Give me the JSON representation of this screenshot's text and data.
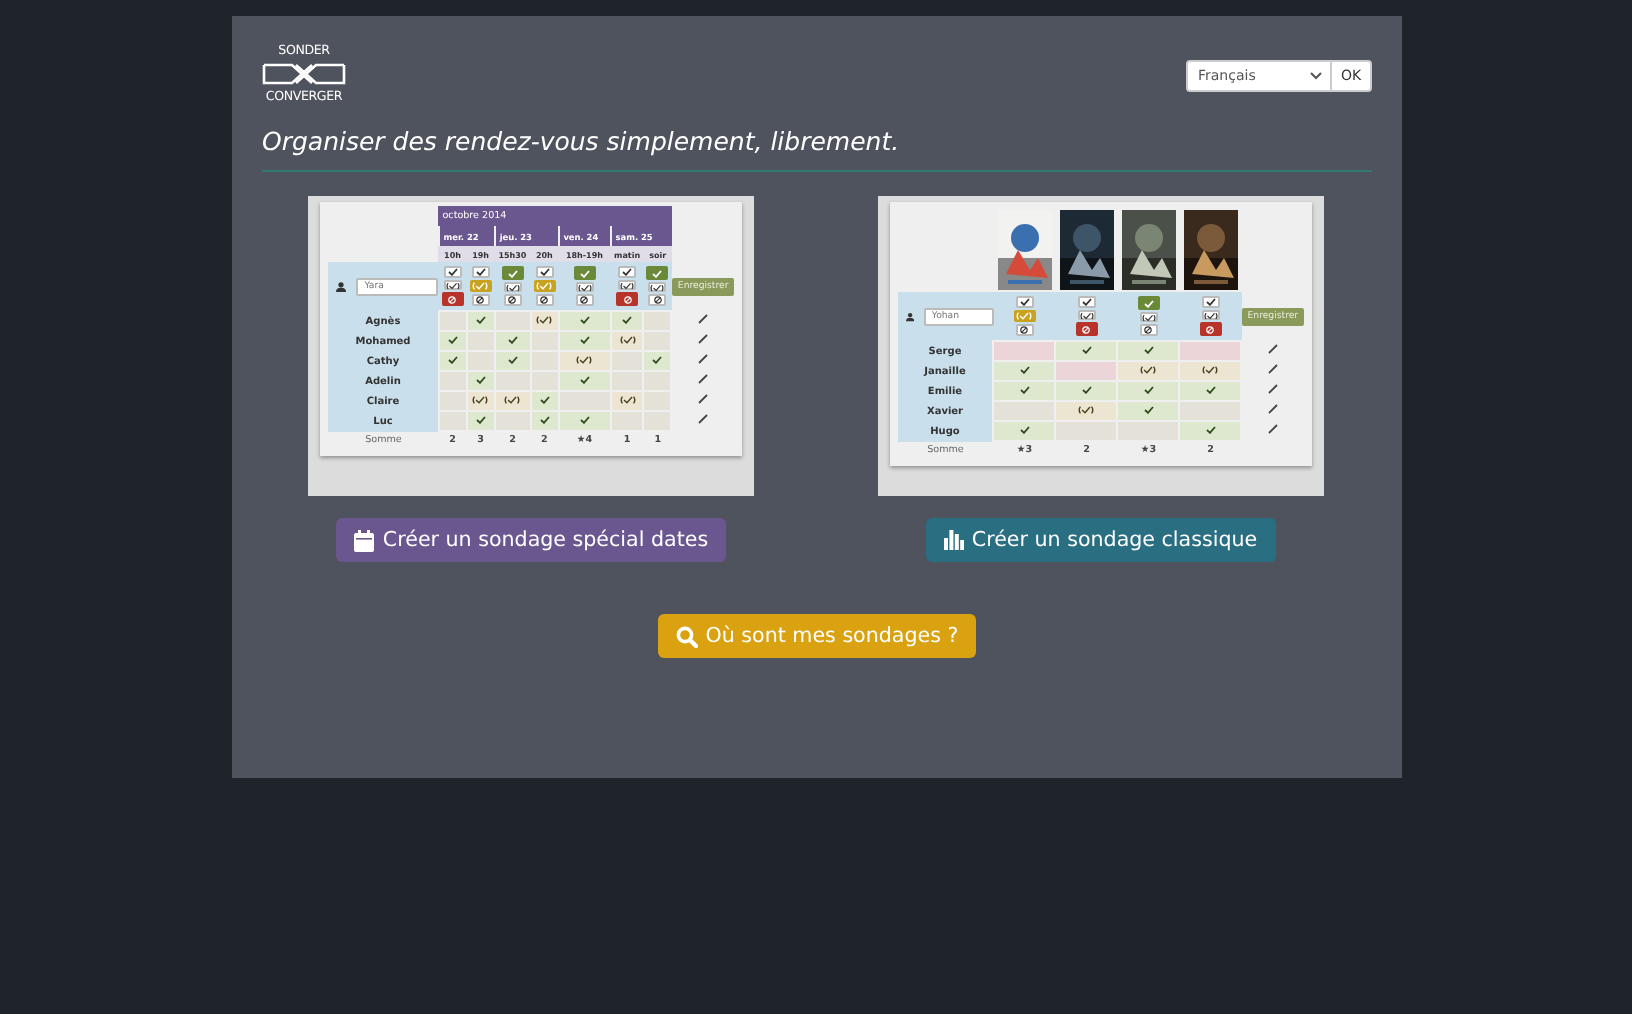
{
  "logo": {
    "top": "SONDER",
    "bottom": "CONVERGER"
  },
  "language": {
    "value": "Français",
    "button": "OK"
  },
  "tagline": "Organiser des rendez-vous simplement, librement.",
  "examples": [
    {
      "kind": "dates",
      "month": "octobre 2014",
      "days": [
        {
          "label": "mer. 22",
          "hours": [
            "10h",
            "19h"
          ]
        },
        {
          "label": "jeu. 23",
          "hours": [
            "15h30",
            "20h"
          ]
        },
        {
          "label": "ven. 24",
          "hours": [
            "18h-19h"
          ]
        },
        {
          "label": "sam. 25",
          "hours": [
            "matin",
            "soir"
          ]
        }
      ],
      "name_field": {
        "value": "Yara"
      },
      "choices": [
        {
          "kind": "no"
        },
        {
          "kind": "maybe"
        },
        {
          "kind": "yes"
        },
        {
          "kind": "maybe"
        },
        {
          "kind": "yes"
        },
        {
          "kind": "no"
        },
        {
          "kind": "yes"
        }
      ],
      "save": "Enregistrer",
      "participants": [
        {
          "name": "Agnès",
          "votes": [
            {
              "kind": "none"
            },
            {
              "kind": "yes"
            },
            {
              "kind": "none"
            },
            {
              "kind": "maybe"
            },
            {
              "kind": "yes"
            },
            {
              "kind": "yes"
            },
            {
              "kind": "none"
            }
          ]
        },
        {
          "name": "Mohamed",
          "votes": [
            {
              "kind": "yes"
            },
            {
              "kind": "none"
            },
            {
              "kind": "yes"
            },
            {
              "kind": "none"
            },
            {
              "kind": "yes"
            },
            {
              "kind": "maybe"
            },
            {
              "kind": "none"
            }
          ]
        },
        {
          "name": "Cathy",
          "votes": [
            {
              "kind": "yes"
            },
            {
              "kind": "none"
            },
            {
              "kind": "yes"
            },
            {
              "kind": "none"
            },
            {
              "kind": "maybe"
            },
            {
              "kind": "none"
            },
            {
              "kind": "yes"
            }
          ]
        },
        {
          "name": "Adelin",
          "votes": [
            {
              "kind": "none"
            },
            {
              "kind": "yes"
            },
            {
              "kind": "none"
            },
            {
              "kind": "none"
            },
            {
              "kind": "yes"
            },
            {
              "kind": "none"
            },
            {
              "kind": "none"
            }
          ]
        },
        {
          "name": "Claire",
          "votes": [
            {
              "kind": "none"
            },
            {
              "kind": "maybe"
            },
            {
              "kind": "maybe"
            },
            {
              "kind": "yes"
            },
            {
              "kind": "none"
            },
            {
              "kind": "maybe"
            },
            {
              "kind": "none"
            }
          ]
        },
        {
          "name": "Luc",
          "votes": [
            {
              "kind": "none"
            },
            {
              "kind": "yes"
            },
            {
              "kind": "none"
            },
            {
              "kind": "yes"
            },
            {
              "kind": "yes"
            },
            {
              "kind": "none"
            },
            {
              "kind": "none"
            }
          ]
        }
      ],
      "total_label": "Somme",
      "totals": [
        "2",
        "3",
        "2",
        "2",
        "★4",
        "1",
        "1"
      ]
    },
    {
      "kind": "classic",
      "options": [
        {
          "kind": "picture"
        },
        {
          "kind": "picture"
        },
        {
          "kind": "picture"
        },
        {
          "kind": "picture"
        }
      ],
      "name_field": {
        "value": "Yohan"
      },
      "choices": [
        {
          "kind": "maybe"
        },
        {
          "kind": "no"
        },
        {
          "kind": "yes"
        },
        {
          "kind": "no"
        }
      ],
      "save": "Enregistrer",
      "participants": [
        {
          "name": "Serge",
          "votes": [
            {
              "kind": "no"
            },
            {
              "kind": "yes"
            },
            {
              "kind": "yes"
            },
            {
              "kind": "no"
            }
          ]
        },
        {
          "name": "Janaille",
          "votes": [
            {
              "kind": "yes"
            },
            {
              "kind": "no"
            },
            {
              "kind": "maybe"
            },
            {
              "kind": "maybe"
            }
          ]
        },
        {
          "name": "Emilie",
          "votes": [
            {
              "kind": "yes"
            },
            {
              "kind": "yes"
            },
            {
              "kind": "yes"
            },
            {
              "kind": "yes"
            }
          ]
        },
        {
          "name": "Xavier",
          "votes": [
            {
              "kind": "none"
            },
            {
              "kind": "maybe"
            },
            {
              "kind": "yes"
            },
            {
              "kind": "none"
            }
          ]
        },
        {
          "name": "Hugo",
          "votes": [
            {
              "kind": "yes"
            },
            {
              "kind": "none"
            },
            {
              "kind": "none"
            },
            {
              "kind": "yes"
            }
          ]
        }
      ],
      "total_label": "Somme",
      "totals": [
        "★3",
        "2",
        "★3",
        "2"
      ]
    }
  ],
  "buttons": [
    {
      "label": "Créer un sondage spécial dates",
      "kind": "dates"
    },
    {
      "label": "Créer un sondage classique",
      "kind": "classic"
    }
  ],
  "search_button": {
    "label": "Où sont mes sondages ?"
  }
}
